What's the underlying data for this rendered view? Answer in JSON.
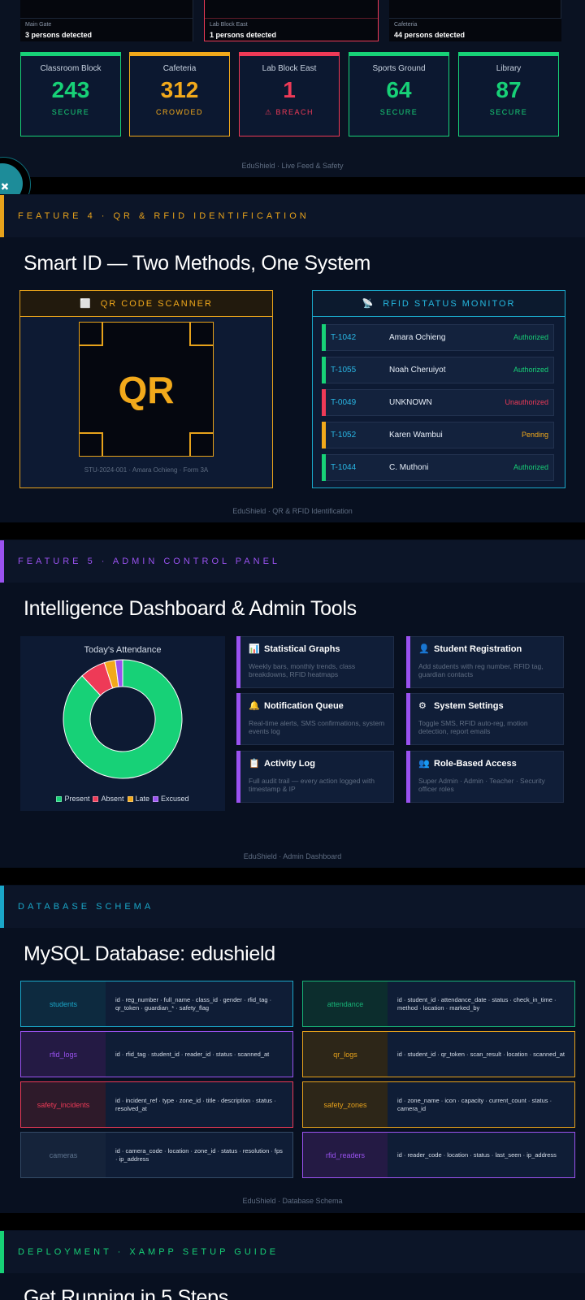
{
  "live_feed": {
    "feeds": [
      {
        "caption": "Main Gate",
        "count": "3 persons detected"
      },
      {
        "caption": "Lab Block East",
        "count": "1 persons detected"
      },
      {
        "caption": "Cafeteria",
        "count": "44 persons detected"
      }
    ],
    "zones": [
      {
        "name": "Classroom Block",
        "count": "243",
        "status": "SECURE",
        "color": "#17d177"
      },
      {
        "name": "Cafeteria",
        "count": "312",
        "status": "CROWDED",
        "color": "#f2a91b"
      },
      {
        "name": "Lab Block East",
        "count": "1",
        "status": "⚠ BREACH",
        "color": "#ee3a57"
      },
      {
        "name": "Sports Ground",
        "count": "64",
        "status": "SECURE",
        "color": "#17d177"
      },
      {
        "name": "Library",
        "count": "87",
        "status": "SECURE",
        "color": "#17d177"
      }
    ],
    "footer": "EduShield · Live Feed & Safety"
  },
  "feature4": {
    "label": "FEATURE 4 · QR & RFID IDENTIFICATION",
    "title": "Smart ID — Two Methods, One System",
    "qr": {
      "header": "QR CODE SCANNER",
      "header_icon": "qr-scan-icon",
      "text": "QR",
      "caption": "STU-2024-001 · Amara Ochieng · Form 3A"
    },
    "rfid": {
      "header": "RFID STATUS MONITOR",
      "header_icon": "antenna-icon",
      "rows": [
        {
          "tag": "T-1042",
          "name": "Amara Ochieng",
          "status": "Authorized",
          "color": "#17d177"
        },
        {
          "tag": "T-1055",
          "name": "Noah Cheruiyot",
          "status": "Authorized",
          "color": "#17d177"
        },
        {
          "tag": "T-0049",
          "name": "UNKNOWN",
          "status": "Unauthorized",
          "color": "#ee3a57"
        },
        {
          "tag": "T-1052",
          "name": "Karen Wambui",
          "status": "Pending",
          "color": "#f2a91b"
        },
        {
          "tag": "T-1044",
          "name": "C. Muthoni",
          "status": "Authorized",
          "color": "#17d177"
        }
      ]
    },
    "footer": "EduShield · QR & RFID Identification"
  },
  "feature5": {
    "label": "FEATURE 5 · ADMIN CONTROL PANEL",
    "title": "Intelligence Dashboard & Admin Tools",
    "attendance_title": "Today's Attendance",
    "tools": [
      {
        "icon": "bar-chart-icon",
        "glyph": "📊",
        "title": "Statistical Graphs",
        "desc": "Weekly bars, monthly trends, class breakdowns, RFID heatmaps"
      },
      {
        "icon": "user-icon",
        "glyph": "👤",
        "title": "Student Registration",
        "desc": "Add students with reg number, RFID tag, guardian contacts"
      },
      {
        "icon": "bell-icon",
        "glyph": "🔔",
        "title": "Notification Queue",
        "desc": "Real-time alerts, SMS confirmations, system events log"
      },
      {
        "icon": "gear-icon",
        "glyph": "⚙",
        "title": "System Settings",
        "desc": "Toggle SMS, RFID auto-reg, motion detection, report emails"
      },
      {
        "icon": "clipboard-icon",
        "glyph": "📋",
        "title": "Activity Log",
        "desc": "Full audit trail — every action logged with timestamp & IP"
      },
      {
        "icon": "users-icon",
        "glyph": "👥",
        "title": "Role-Based Access",
        "desc": "Super Admin · Admin · Teacher · Security officer roles"
      }
    ],
    "footer": "EduShield · Admin Dashboard"
  },
  "chart_data": {
    "type": "pie",
    "title": "Today's Attendance",
    "categories": [
      "Present",
      "Absent",
      "Late",
      "Excused"
    ],
    "values": [
      88,
      7,
      3,
      2
    ],
    "colors": [
      "#17d177",
      "#ee3a57",
      "#f2a91b",
      "#9a52f0"
    ],
    "legend": "bottom"
  },
  "database": {
    "label": "DATABASE SCHEMA",
    "title": "MySQL Database: edushield",
    "tables": [
      {
        "name": "students",
        "cols": "id · reg_number · full_name · class_id · gender · rfid_tag · qr_token · guardian_* · safety_flag",
        "color": "#1aa7c9",
        "bg": "#0d2a3f"
      },
      {
        "name": "attendance",
        "cols": "id · student_id · attendance_date · status · check_in_time · method · location · marked_by",
        "color": "#17b377",
        "bg": "#0c2d2d"
      },
      {
        "name": "rfid_logs",
        "cols": "id · rfid_tag · student_id · reader_id · status · scanned_at",
        "color": "#9a52f0",
        "bg": "#241a44"
      },
      {
        "name": "qr_logs",
        "cols": "id · student_id · qr_token · scan_result · location · scanned_at",
        "color": "#e7a21b",
        "bg": "#2d2618"
      },
      {
        "name": "safety_incidents",
        "cols": "id · incident_ref · type · zone_id · title · description · status · resolved_at",
        "color": "#ee3a57",
        "bg": "#2e1a2a"
      },
      {
        "name": "safety_zones",
        "cols": "id · zone_name · icon · capacity · current_count · status · camera_id",
        "color": "#e7a21b",
        "bg": "#2d2618"
      },
      {
        "name": "cameras",
        "cols": "id · camera_code · location · zone_id · status · resolution · fps · ip_address",
        "color": "#334a66",
        "bg": "#15233a"
      },
      {
        "name": "rfid_readers",
        "cols": "id · reader_code · location · status · last_seen · ip_address",
        "color": "#9a52f0",
        "bg": "#241a44"
      }
    ],
    "footer": "EduShield · Database Schema"
  },
  "deployment": {
    "label": "DEPLOYMENT · XAMPP SETUP GUIDE",
    "title": "Get Running in 5 Steps"
  }
}
